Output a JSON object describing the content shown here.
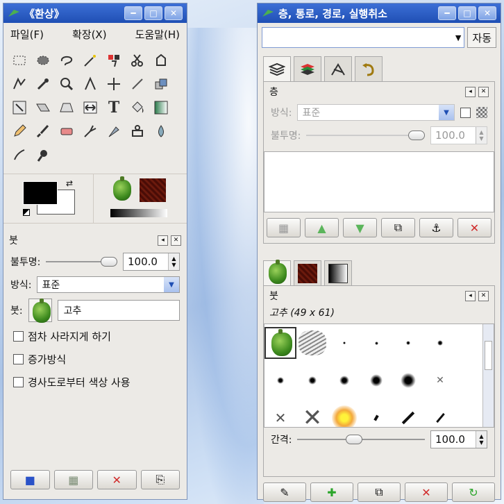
{
  "toolbox": {
    "title": "《환상》",
    "menu": [
      "파일(F)",
      "확장(X)",
      "도움말(H)"
    ],
    "tool_icons": [
      "rect-select-icon",
      "ellipse-select-icon",
      "lasso-icon",
      "magic-wand-icon",
      "select-by-color-icon",
      "scissors-icon",
      "foreground-select-icon",
      "paths-icon",
      "color-picker-icon",
      "zoom-icon",
      "measure-icon",
      "move-icon",
      "crop-icon",
      "rotate-icon",
      "scale-icon",
      "shear-icon",
      "perspective-icon",
      "flip-icon",
      "text-icon",
      "bucket-fill-icon",
      "blend-icon",
      "pencil-icon",
      "paintbrush-icon",
      "eraser-icon",
      "airbrush-icon",
      "ink-icon",
      "clone-icon",
      "heal-icon",
      "smudge-icon",
      "dodge-burn-icon"
    ],
    "colors": {
      "fg": "#000000",
      "bg": "#ffffff"
    }
  },
  "brush_options": {
    "title": "붓",
    "opacity_label": "불투명:",
    "opacity_value": "100.0",
    "mode_label": "방식:",
    "mode_value": "표준",
    "brush_label": "붓:",
    "brush_name": "고추",
    "checkboxes": [
      "점차 사라지게 하기",
      "증가방식",
      "경사도로부터 색상 사용"
    ]
  },
  "layers_dock": {
    "title": "층, 통로, 경로, 실행취소",
    "auto_button": "자동",
    "panel_title": "층",
    "mode_label": "방식:",
    "mode_value": "표준",
    "opacity_label": "불투명:",
    "opacity_value": "100.0"
  },
  "brushes_dock": {
    "title": "붓",
    "brush_info": "고추 (49 x 61)",
    "spacing_label": "간격:",
    "spacing_value": "100.0"
  }
}
